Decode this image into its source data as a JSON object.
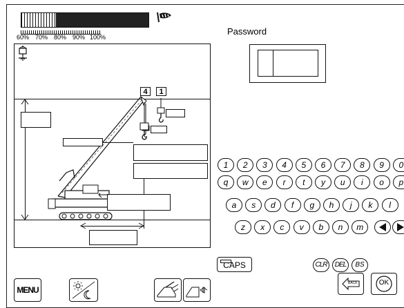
{
  "load_gauge": {
    "scale_labels": [
      "60%",
      "70%",
      "80%",
      "90%",
      "100%"
    ],
    "fill_fraction": 0.27
  },
  "crane_diagram": {
    "badge_left": "4",
    "badge_right": "1"
  },
  "password": {
    "label": "Password",
    "value": ""
  },
  "keyboard": {
    "row1": [
      "1",
      "2",
      "3",
      "4",
      "5",
      "6",
      "7",
      "8",
      "9",
      "0"
    ],
    "row2": [
      "q",
      "w",
      "e",
      "r",
      "t",
      "y",
      "u",
      "i",
      "o",
      "p"
    ],
    "row3": [
      "a",
      "s",
      "d",
      "f",
      "g",
      "h",
      "j",
      "k",
      "l"
    ],
    "row4": [
      "z",
      "x",
      "c",
      "v",
      "b",
      "n",
      "m"
    ],
    "caps": "CAPS",
    "clear": "CLR",
    "delete": "DEL",
    "backspace": "BS",
    "left_icon": "arrow-left-icon",
    "right_icon": "arrow-right-icon"
  },
  "bottom_bar": {
    "menu": "MENU",
    "back": "BACK",
    "ok": "OK"
  }
}
